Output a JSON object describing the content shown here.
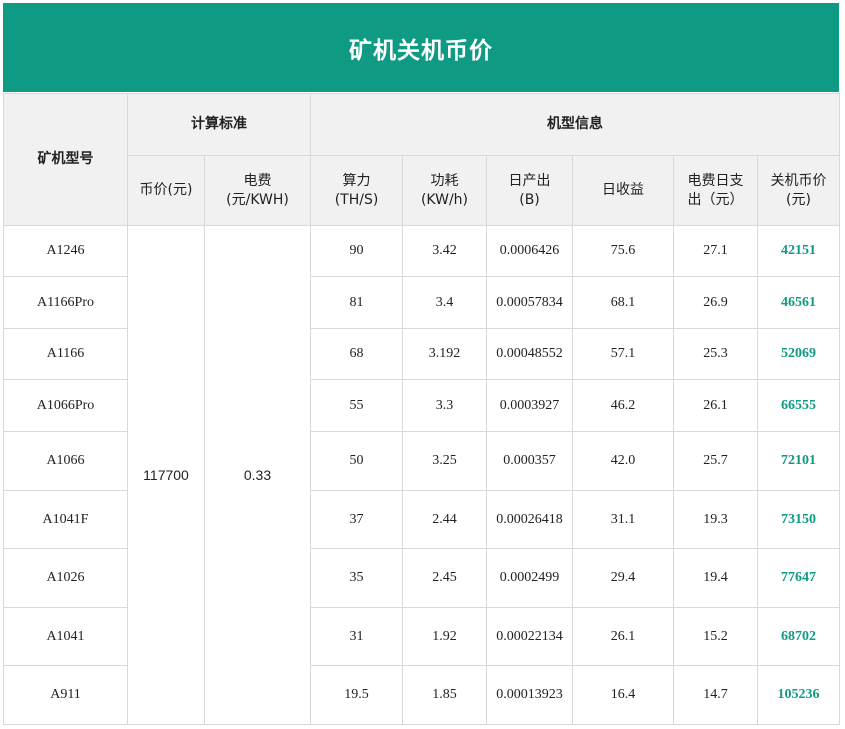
{
  "title": "矿机关机币价",
  "headers": {
    "model": "矿机型号",
    "calc_standard": "计算标准",
    "model_info": "机型信息",
    "coin_price_line1": "币价(元)",
    "elec_price_line1": "电费",
    "elec_price_line2": "(元/KWH)",
    "hashrate_line1": "算力",
    "hashrate_line2": "(TH/S)",
    "power_line1": "功耗",
    "power_line2": "(KW/h)",
    "daily_output_line1": "日产出",
    "daily_output_line2": "(B)",
    "daily_income": "日收益",
    "daily_elec_line1": "电费日支",
    "daily_elec_line2": "出（元）",
    "shutdown_price_line1": "关机币价",
    "shutdown_price_line2": "(元)"
  },
  "shared": {
    "coin_price": "117700",
    "elec_price": "0.33"
  },
  "colors": {
    "accent": "#0f9a83"
  },
  "rows": [
    {
      "model": "A1246",
      "hashrate": "90",
      "power": "3.42",
      "output": "0.0006426",
      "income": "75.6",
      "elec": "27.1",
      "shutdown": "42151"
    },
    {
      "model": "A1166Pro",
      "hashrate": "81",
      "power": "3.4",
      "output": "0.00057834",
      "income": "68.1",
      "elec": "26.9",
      "shutdown": "46561"
    },
    {
      "model": "A1166",
      "hashrate": "68",
      "power": "3.192",
      "output": "0.00048552",
      "income": "57.1",
      "elec": "25.3",
      "shutdown": "52069"
    },
    {
      "model": "A1066Pro",
      "hashrate": "55",
      "power": "3.3",
      "output": "0.0003927",
      "income": "46.2",
      "elec": "26.1",
      "shutdown": "66555"
    },
    {
      "model": "A1066",
      "hashrate": "50",
      "power": "3.25",
      "output": "0.000357",
      "income": "42.0",
      "elec": "25.7",
      "shutdown": "72101"
    },
    {
      "model": "A1041F",
      "hashrate": "37",
      "power": "2.44",
      "output": "0.00026418",
      "income": "31.1",
      "elec": "19.3",
      "shutdown": "73150"
    },
    {
      "model": "A1026",
      "hashrate": "35",
      "power": "2.45",
      "output": "0.0002499",
      "income": "29.4",
      "elec": "19.4",
      "shutdown": "77647"
    },
    {
      "model": "A1041",
      "hashrate": "31",
      "power": "1.92",
      "output": "0.00022134",
      "income": "26.1",
      "elec": "15.2",
      "shutdown": "68702"
    },
    {
      "model": "A911",
      "hashrate": "19.5",
      "power": "1.85",
      "output": "0.00013923",
      "income": "16.4",
      "elec": "14.7",
      "shutdown": "105236"
    }
  ]
}
